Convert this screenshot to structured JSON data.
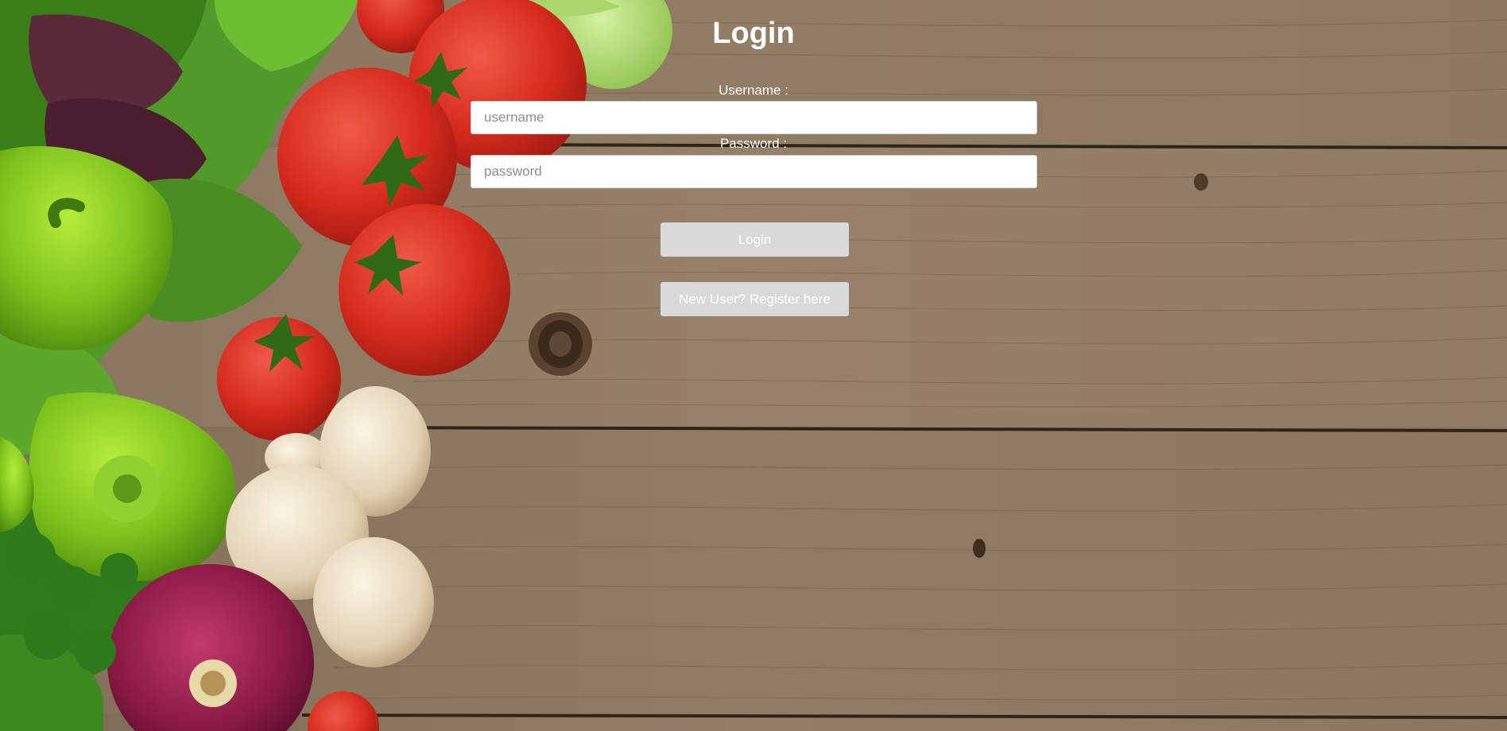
{
  "login": {
    "title": "Login",
    "username_label": "Username :",
    "username_placeholder": "username",
    "password_label": "Password :",
    "password_placeholder": "password",
    "login_button": "Login",
    "register_button": "New User? Register here"
  },
  "colors": {
    "text": "#ffffff",
    "button_bg": "#d9d9d9",
    "input_bg": "#ffffff",
    "wood": "#8a7560"
  }
}
